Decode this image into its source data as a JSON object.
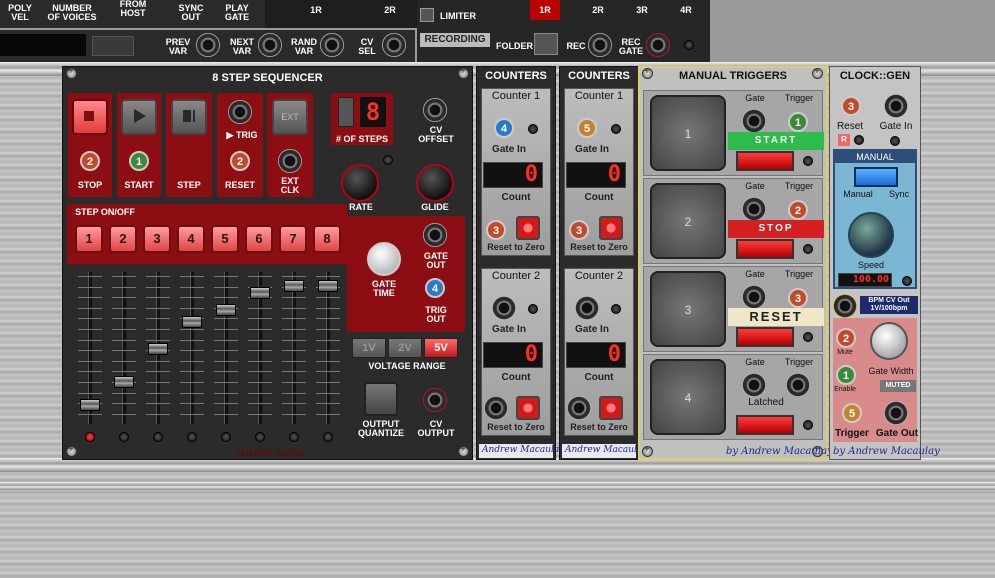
{
  "top_bar": {
    "labels": [
      "POLY\nVEL",
      "NUMBER\nOF VOICES",
      "FROM\nHOST",
      "SYNC\nOUT",
      "PLAY\nGATE"
    ],
    "cv_labels": [
      "PREV\nVAR",
      "NEXT\nVAR",
      "RAND\nVAR",
      "CV\nSEL"
    ],
    "right": {
      "channels": [
        "1R",
        "2R"
      ],
      "limiter": "LIMITER",
      "recording": "RECORDING",
      "folder": "FOLDER",
      "rec": "REC",
      "rec_gate": "REC\nGATE",
      "outs": [
        "1R",
        "2R",
        "3R",
        "4R"
      ]
    }
  },
  "sequencer": {
    "title": "8 STEP SEQUENCER",
    "buttons": [
      "STOP",
      "START",
      "STEP",
      "RESET",
      "EXT\nCLK"
    ],
    "trig": "▶ TRIG",
    "ext": "EXT",
    "steps_display": "8",
    "steps_label": "# OF STEPS",
    "cv_offset": "CV\nOFFSET",
    "rate": "RATE",
    "glide": "GLIDE",
    "step_onoff": "STEP ON/OFF",
    "step_numbers": [
      "1",
      "2",
      "3",
      "4",
      "5",
      "6",
      "7",
      "8"
    ],
    "gate_time": "GATE\nTIME",
    "gate_out": "GATE\nOUT",
    "trig_out": "TRIG\nOUT",
    "voltage_range": "VOLTAGE RANGE",
    "ranges": [
      "1V",
      "2V",
      "5V"
    ],
    "selected_range": "5V",
    "output_quantize": "OUTPUT\nQUANTIZE",
    "cv_output": "CV\nOUTPUT",
    "brand": "CHERRY AUDIO",
    "badges": {
      "stop": "2",
      "start": "1",
      "reset": "2"
    },
    "trig_out_badge": "4",
    "slider_levels": [
      0.1,
      0.27,
      0.52,
      0.73,
      0.82,
      0.95,
      1.0,
      1.0
    ]
  },
  "counters": [
    {
      "title": "COUNTERS",
      "c1": "Counter 1",
      "c2": "Counter 2",
      "gate_in": "Gate In",
      "count": "Count",
      "reset": "Reset to Zero",
      "display1": "0",
      "display2": "0",
      "badge1": "4",
      "badge_reset": "3",
      "sig": "Andrew Macaulay"
    },
    {
      "title": "COUNTERS",
      "c1": "Counter 1",
      "c2": "Counter 2",
      "gate_in": "Gate In",
      "count": "Count",
      "reset": "Reset to Zero",
      "display1": "0",
      "display2": "0",
      "badge1": "5",
      "badge_reset": "3",
      "sig": "Andrew Macaulay"
    }
  ],
  "manual": {
    "title": "MANUAL TRIGGERS",
    "pads": [
      "1",
      "2",
      "3",
      "4"
    ],
    "gate": "Gate",
    "trigger": "Trigger",
    "tags": [
      "START",
      "STOP",
      "RESET"
    ],
    "latched": "Latched",
    "badges": [
      "1",
      "2",
      "3"
    ],
    "sig": "by Andrew Macaulay"
  },
  "clock": {
    "title": "CLOCK::GEN",
    "reset": "Reset",
    "gate_in": "Gate In",
    "r": "R",
    "manual": "MANUAL",
    "manual_lbl": "Manual",
    "sync": "Sync",
    "speed": "Speed",
    "display": "100.00",
    "bpm": "BPM CV Out\n1V/100bpm",
    "mute": "Mute",
    "enable": "Enable",
    "gate_width": "Gate Width",
    "muted": "MUTED",
    "trigger": "Trigger",
    "gate_out": "Gate Out",
    "badges": [
      "3",
      "2",
      "1",
      "5"
    ],
    "sig": "by Andrew Macaulay"
  },
  "colors": {
    "seq_red": "#8c0e12",
    "panel_dark": "#2b2b2b",
    "manual_border": "#d9d06a",
    "clock_blue": "#3a8fd8"
  }
}
